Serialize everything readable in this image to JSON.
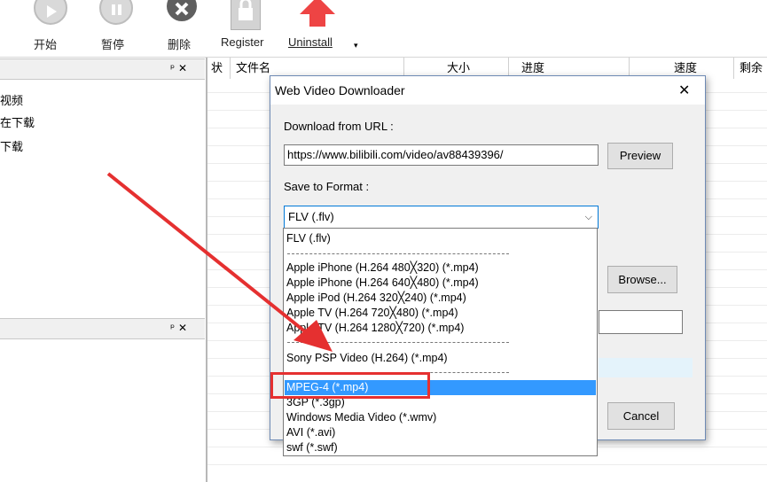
{
  "toolbar": {
    "start_label": "开始",
    "pause_label": "暂停",
    "delete_label": "删除",
    "register_label": "Register",
    "uninstall_label": "Uninstall"
  },
  "left_pane": {
    "pin_glyph": "ᵖ ✕",
    "items": [
      "视频",
      "在下载",
      "下载"
    ]
  },
  "list_columns": [
    "状",
    "文件名",
    "大小",
    "进度",
    "速度",
    "剩余"
  ],
  "dialog": {
    "title": "Web Video Downloader",
    "close_glyph": "✕",
    "url_label": "Download from URL :",
    "url_value": "https://www.bilibili.com/video/av88439396/",
    "preview_label": "Preview",
    "format_label": "Save to Format :",
    "format_value": "FLV (.flv)",
    "browse_label": "Browse...",
    "cancel_label": "Cancel"
  },
  "format_options": {
    "flv": "FLV (.flv)",
    "iphone1": "Apple iPhone   (H.264 480╳320) (*.mp4)",
    "iphone2": "Apple iPhone    (H.264 640╳480) (*.mp4)",
    "ipod": "Apple iPod    (H.264 320╳240) (*.mp4)",
    "tv1": "Apple TV    (H.264 720╳480) (*.mp4)",
    "tv2": "Apple TV    (H.264 1280╳720) (*.mp4)",
    "psp": "Sony PSP Video    (H.264) (*.mp4)",
    "mpeg4": "MPEG-4 (*.mp4)",
    "3gp": "3GP (*.3gp)",
    "wmv": "Windows Media Video (*.wmv)",
    "avi": "AVI (*.avi)",
    "swf": "swf (*.swf)"
  },
  "colors": {
    "selection": "#3399ff",
    "annotation": "#e53030"
  }
}
